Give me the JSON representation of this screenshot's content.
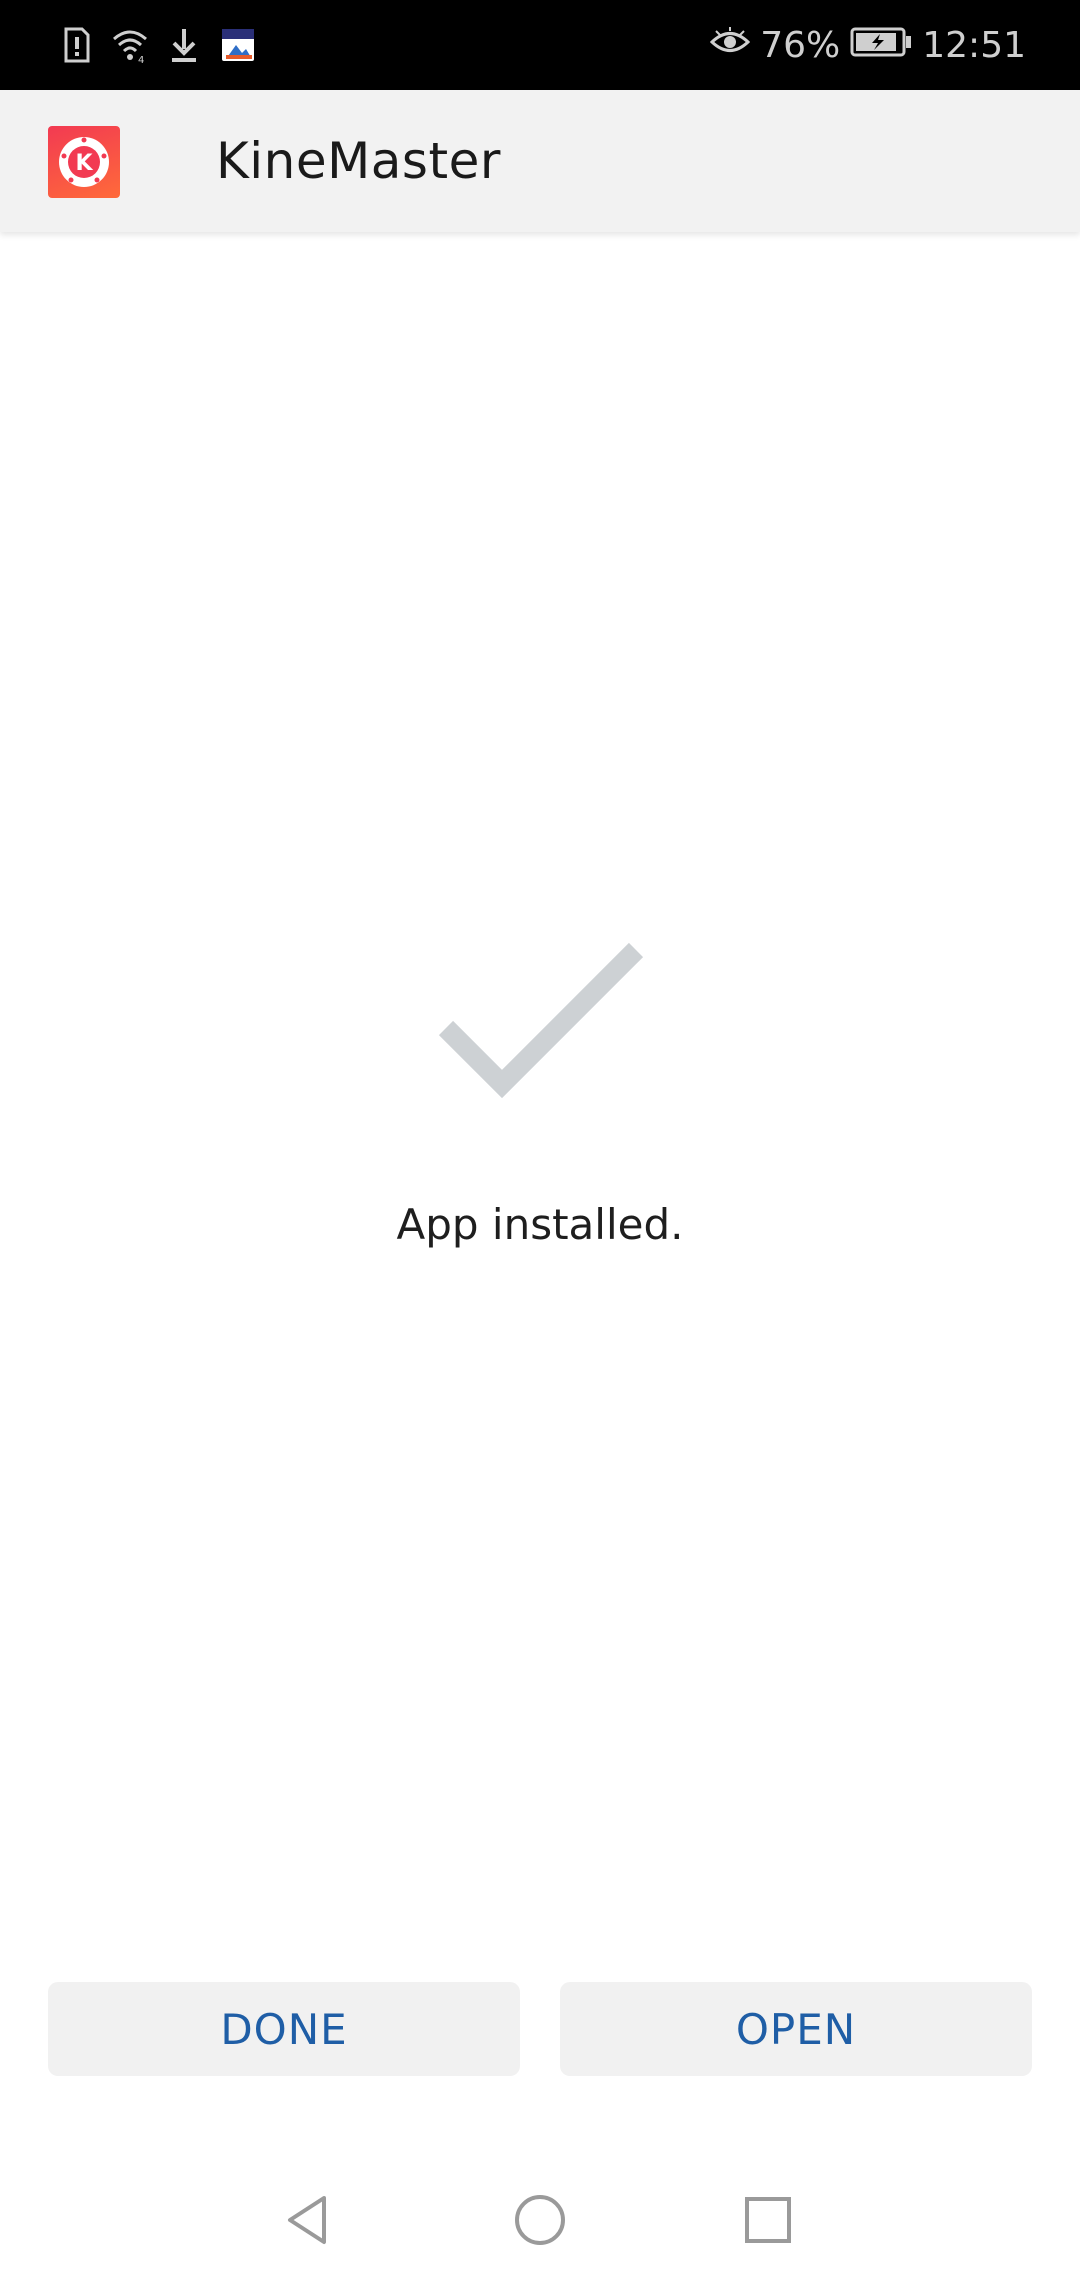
{
  "status_bar": {
    "battery_percent": "76%",
    "time": "12:51",
    "icons": [
      "sim-alert-icon",
      "wifi-icon",
      "download-icon",
      "app-notification-icon",
      "eye-comfort-icon",
      "battery-charging-icon"
    ]
  },
  "app_bar": {
    "app_name": "KineMaster",
    "logo_letter": "K",
    "logo_colors": [
      "#f23a52",
      "#ff6a3a"
    ]
  },
  "content": {
    "status_message": "App installed.",
    "check_color": "#cdd1d4"
  },
  "actions": {
    "done_label": "DONE",
    "open_label": "OPEN",
    "label_color": "#1f5ea6"
  },
  "navigation": {
    "icons": [
      "back-icon",
      "home-icon",
      "recents-icon"
    ]
  }
}
